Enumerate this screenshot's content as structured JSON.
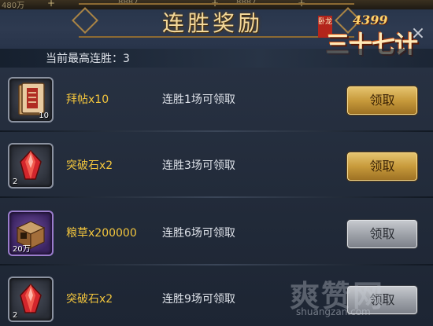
{
  "topbar": {
    "resources": [
      "480万",
      "8887",
      "8887"
    ]
  },
  "title": "连胜奖励",
  "logo": {
    "main": "三十七计",
    "number": "4399",
    "seal": "卧龙"
  },
  "subtitle": "当前最高连胜：3",
  "rewards": [
    {
      "name": "拜帖x10",
      "quantity": "10",
      "condition": "连胜1场可领取",
      "button": "领取",
      "state": "available",
      "icon": "invitation-scroll-icon"
    },
    {
      "name": "突破石x2",
      "quantity": "2",
      "condition": "连胜3场可领取",
      "button": "领取",
      "state": "available",
      "icon": "red-crystal-icon"
    },
    {
      "name": "粮草x200000",
      "quantity": "20万",
      "condition": "连胜6场可领取",
      "button": "领取",
      "state": "disabled",
      "icon": "grain-crate-icon"
    },
    {
      "name": "突破石x2",
      "quantity": "2",
      "condition": "连胜9场可领取",
      "button": "领取",
      "state": "disabled",
      "icon": "red-crystal-icon"
    }
  ],
  "watermark": {
    "main": "爽赞网",
    "url": "shuangzan.com"
  },
  "colors": {
    "item_name": "#f2c53d",
    "button_gold": "#c79a3b",
    "button_grey": "#9fa3aa",
    "title": "#f3d89a"
  }
}
